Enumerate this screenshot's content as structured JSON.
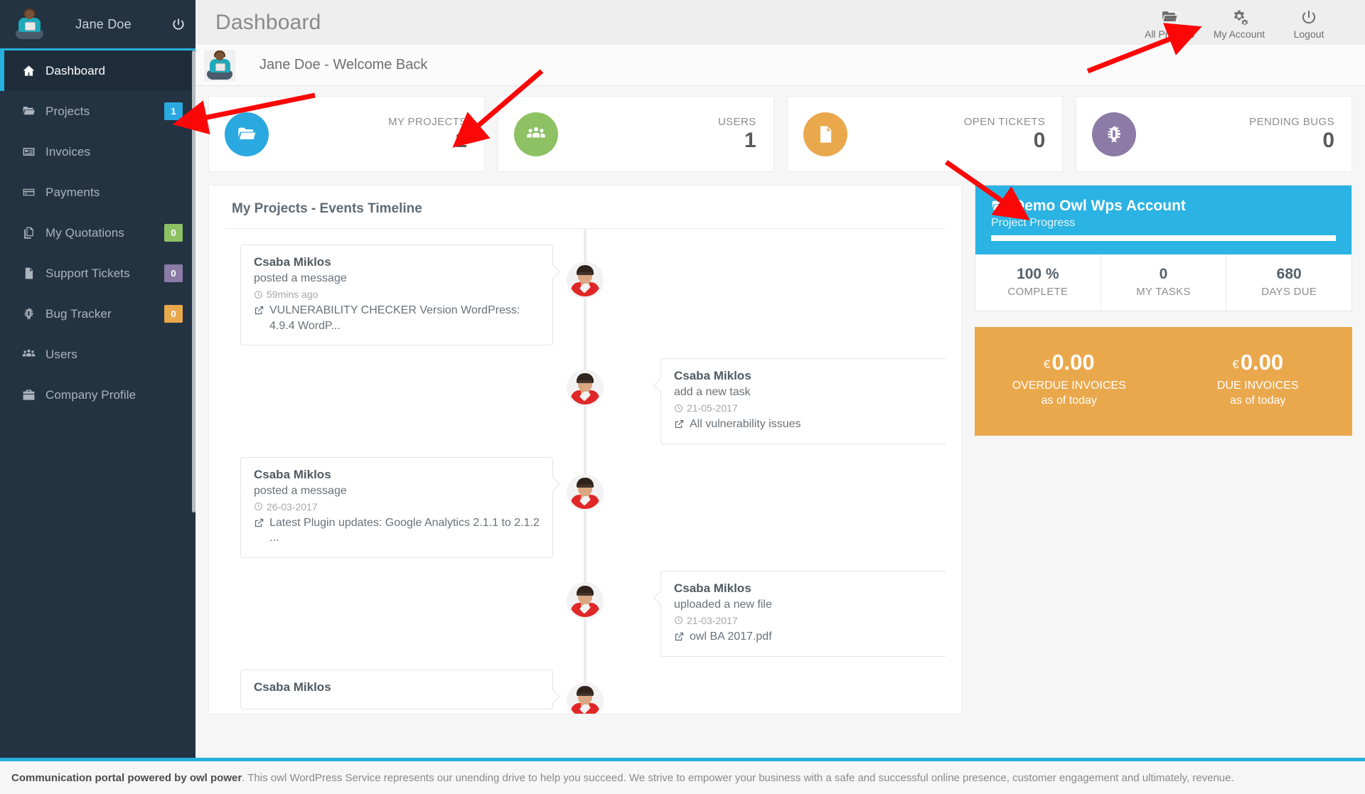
{
  "sidebar": {
    "user_name": "Jane Doe",
    "power_icon": "power-icon",
    "items": [
      {
        "label": "Dashboard",
        "icon": "home-icon",
        "badge": null,
        "badge_color": null,
        "active": true
      },
      {
        "label": "Projects",
        "icon": "folder-icon",
        "badge": "1",
        "badge_color": "#29a9e0",
        "active": false
      },
      {
        "label": "Invoices",
        "icon": "invoice-icon",
        "badge": null,
        "badge_color": null,
        "active": false
      },
      {
        "label": "Payments",
        "icon": "card-icon",
        "badge": null,
        "badge_color": null,
        "active": false
      },
      {
        "label": "My Quotations",
        "icon": "copy-icon",
        "badge": "0",
        "badge_color": "#8dc163",
        "active": false
      },
      {
        "label": "Support Tickets",
        "icon": "file-icon",
        "badge": "0",
        "badge_color": "#8b7ba6",
        "active": false
      },
      {
        "label": "Bug Tracker",
        "icon": "bug-icon",
        "badge": "0",
        "badge_color": "#eaa84c",
        "active": false
      },
      {
        "label": "Users",
        "icon": "users-icon",
        "badge": null,
        "badge_color": null,
        "active": false
      },
      {
        "label": "Company Profile",
        "icon": "briefcase-icon",
        "badge": null,
        "badge_color": null,
        "active": false
      }
    ]
  },
  "topbar": {
    "title": "Dashboard",
    "actions": [
      {
        "label": "All Projects",
        "icon": "folder-open-icon"
      },
      {
        "label": "My Account",
        "icon": "gear-icon"
      },
      {
        "label": "Logout",
        "icon": "power-icon"
      }
    ]
  },
  "welcome": {
    "text": "Jane Doe - Welcome Back",
    "avatar": "user-avatar"
  },
  "stats": [
    {
      "label": "MY PROJECTS",
      "value": "1",
      "color": "#29a9e0",
      "icon": "folder-open-icon"
    },
    {
      "label": "USERS",
      "value": "1",
      "color": "#8dc163",
      "icon": "users-icon"
    },
    {
      "label": "OPEN TICKETS",
      "value": "0",
      "color": "#eaa84c",
      "icon": "file-icon"
    },
    {
      "label": "PENDING BUGS",
      "value": "0",
      "color": "#8b7ba6",
      "icon": "bug-icon"
    }
  ],
  "timeline": {
    "title": "My Projects - Events Timeline",
    "events": [
      {
        "side": "left",
        "name": "Csaba Miklos",
        "action": "posted a message",
        "time": "59mins ago",
        "link": "VULNERABILITY CHECKER Version WordPress: 4.9.4 WordP..."
      },
      {
        "side": "right",
        "name": "Csaba Miklos",
        "action": "add a new task",
        "time": "21-05-2017",
        "link": "All vulnerability issues"
      },
      {
        "side": "left",
        "name": "Csaba Miklos",
        "action": "posted a message",
        "time": "26-03-2017",
        "link": "Latest Plugin updates: Google Analytics 2.1.1 to 2.1.2 ..."
      },
      {
        "side": "right",
        "name": "Csaba Miklos",
        "action": "uploaded a new file",
        "time": "21-03-2017",
        "link": "owl BA 2017.pdf"
      },
      {
        "side": "left",
        "name": "Csaba Miklos",
        "action": "",
        "time": "",
        "link": ""
      }
    ]
  },
  "project": {
    "name": "Demo Owl Wps Account",
    "subtitle": "Project Progress",
    "progress_percent": 100,
    "header_color": "#2bb3e3",
    "stats": [
      {
        "value": "100 %",
        "label": "COMPLETE"
      },
      {
        "value": "0",
        "label": "MY TASKS"
      },
      {
        "value": "680",
        "label": "DAYS DUE"
      }
    ]
  },
  "invoices": {
    "color": "#eaa84c",
    "columns": [
      {
        "currency": "€",
        "amount": "0.00",
        "label": "OVERDUE INVOICES",
        "sublabel": "as of today"
      },
      {
        "currency": "€",
        "amount": "0.00",
        "label": "DUE INVOICES",
        "sublabel": "as of today"
      }
    ]
  },
  "footer": {
    "strong": "Communication portal powered by owl power",
    "text": ". This owl WordPress Service represents our unending drive to help you succeed. We strive to empower your business with a safe and successful online presence, customer engagement and ultimately, revenue."
  },
  "annotations": {
    "color": "#fb0707",
    "count": 4
  }
}
